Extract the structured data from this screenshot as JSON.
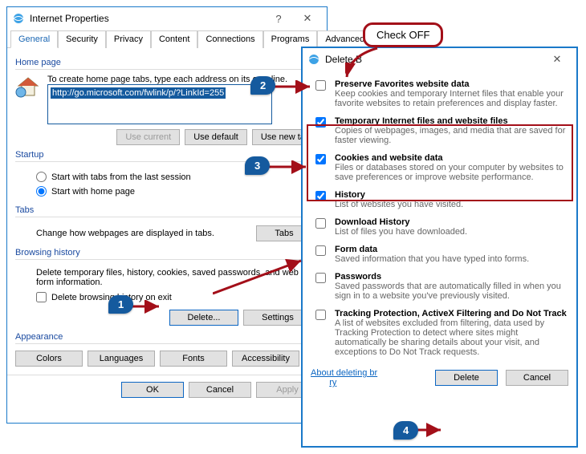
{
  "internet_properties": {
    "title": "Internet Properties",
    "tabs": [
      "General",
      "Security",
      "Privacy",
      "Content",
      "Connections",
      "Programs",
      "Advanced"
    ],
    "home_page": {
      "label": "Home page",
      "hint": "To create home page tabs, type each address on its own line.",
      "url": "http://go.microsoft.com/fwlink/p/?LinkId=255",
      "buttons": {
        "use_current": "Use current",
        "use_default": "Use default",
        "use_new_tab": "Use new tab"
      }
    },
    "startup": {
      "label": "Startup",
      "opt_tabs": "Start with tabs from the last session",
      "opt_home": "Start with home page"
    },
    "tabs_section": {
      "label": "Tabs",
      "text": "Change how webpages are displayed in tabs.",
      "button": "Tabs"
    },
    "browsing_history": {
      "label": "Browsing history",
      "text": "Delete temporary files, history, cookies, saved passwords, and web form information.",
      "chk": "Delete browsing history on exit",
      "delete": "Delete...",
      "settings": "Settings"
    },
    "appearance": {
      "label": "Appearance",
      "buttons": {
        "colors": "Colors",
        "languages": "Languages",
        "fonts": "Fonts",
        "accessibility": "Accessibility"
      }
    },
    "footer": {
      "ok": "OK",
      "cancel": "Cancel",
      "apply": "Apply"
    }
  },
  "delete_dialog": {
    "title": "Delete Browsing History",
    "items": {
      "preserve": {
        "title": "Preserve Favorites website data",
        "desc": "Keep cookies and temporary Internet files that enable your favorite websites to retain preferences and display faster.",
        "checked": false
      },
      "temp": {
        "title": "Temporary Internet files and website files",
        "desc": "Copies of webpages, images, and media that are saved for faster viewing.",
        "checked": true
      },
      "cookies": {
        "title": "Cookies and website data",
        "desc": "Files or databases stored on your computer by websites to save preferences or improve website performance.",
        "checked": true
      },
      "history": {
        "title": "History",
        "desc": "List of websites you have visited.",
        "checked": true
      },
      "dlhistory": {
        "title": "Download History",
        "desc": "List of files you have downloaded.",
        "checked": false
      },
      "form": {
        "title": "Form data",
        "desc": "Saved information that you have typed into forms.",
        "checked": false
      },
      "pw": {
        "title": "Passwords",
        "desc": "Saved passwords that are automatically filled in when you sign in to a website you've previously visited.",
        "checked": false
      },
      "tracking": {
        "title": "Tracking Protection, ActiveX Filtering and Do Not Track",
        "desc": "A list of websites excluded from filtering, data used by Tracking Protection to detect where sites might automatically be sharing details about your visit, and exceptions to Do Not Track requests.",
        "checked": false
      }
    },
    "about_link": "About deleting browsing history",
    "buttons": {
      "delete": "Delete",
      "cancel": "Cancel"
    }
  },
  "annotations": {
    "check_off": "Check OFF",
    "n1": "1",
    "n2": "2",
    "n3": "3",
    "n4": "4"
  }
}
